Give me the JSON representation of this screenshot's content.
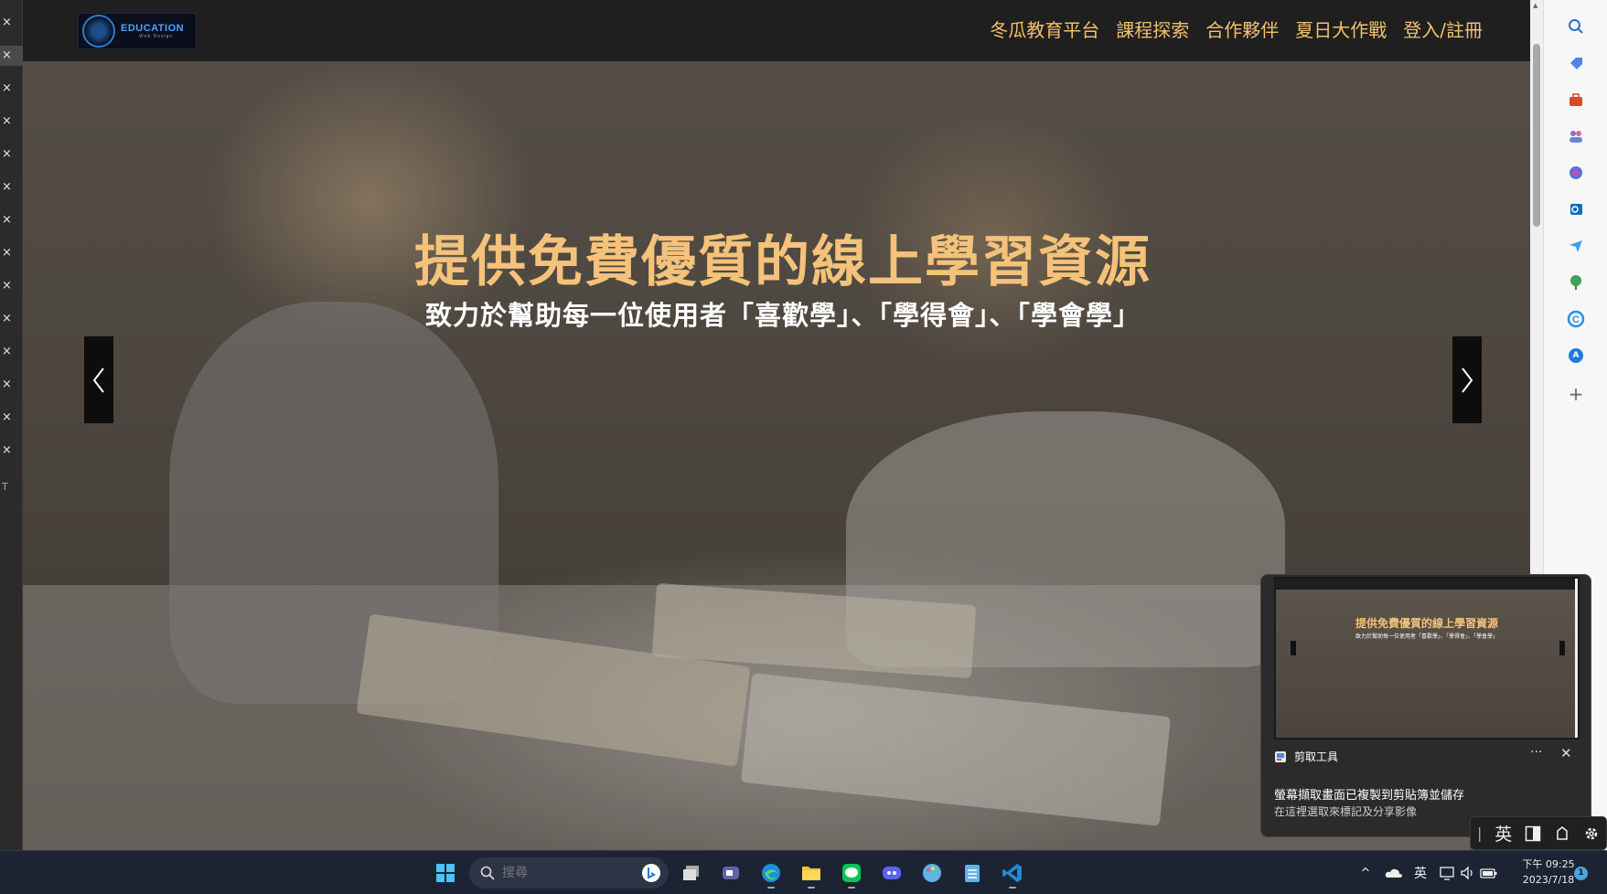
{
  "browser": {
    "left_tabs": {
      "close_glyph": "×",
      "count": 14,
      "mark": "T"
    },
    "right_sidebar": {
      "icons": [
        "search-icon",
        "tag-icon",
        "toolbox-icon",
        "people-icon",
        "copilot-icon",
        "outlook-icon",
        "send-icon",
        "tree-icon",
        "c-icon",
        "a-icon",
        "add-icon"
      ],
      "add_glyph": "+",
      "a_glyph": "A"
    }
  },
  "site": {
    "logo": {
      "title": "EDUCATION",
      "subtitle": "Web Design"
    },
    "nav": [
      {
        "label": "冬瓜教育平台"
      },
      {
        "label": "課程探索"
      },
      {
        "label": "合作夥伴"
      },
      {
        "label": "夏日大作戰"
      },
      {
        "label": "登入/註冊"
      }
    ],
    "hero": {
      "title": "提供免費優質的線上學習資源",
      "subtitle": "致力於幫助每一位使用者「喜歡學」、「學得會」、「學會學」"
    },
    "colors": {
      "accent": "#f2c06e",
      "nav_bg": "#1f1f1f",
      "hero_title": "#f4c27a"
    }
  },
  "notification": {
    "app_name": "剪取工具",
    "more": "···",
    "close": "✕",
    "title": "螢幕擷取畫面已複製到剪貼簿並儲存",
    "body": "在這裡選取來標記及分享影像",
    "thumbnail": {
      "title": "提供免費優質的線上學習資源",
      "subtitle": "致力於幫助每一位使用者「喜歡學」、「學得會」、「學會學」"
    }
  },
  "ime_toolbar": {
    "mode": "英",
    "divider": "|"
  },
  "taskbar": {
    "search_placeholder": "搜尋",
    "apps": [
      "windows-start-icon",
      "search-icon",
      "task-view-icon",
      "teams-icon",
      "edge-icon",
      "file-explorer-icon",
      "line-icon",
      "discord-icon",
      "paint-icon",
      "notepad-icon",
      "vscode-icon"
    ],
    "tray": {
      "chevron": "^",
      "language": "英"
    },
    "clock": {
      "time": "下午 09:25",
      "date": "2023/7/18"
    },
    "notification_count": "1"
  }
}
